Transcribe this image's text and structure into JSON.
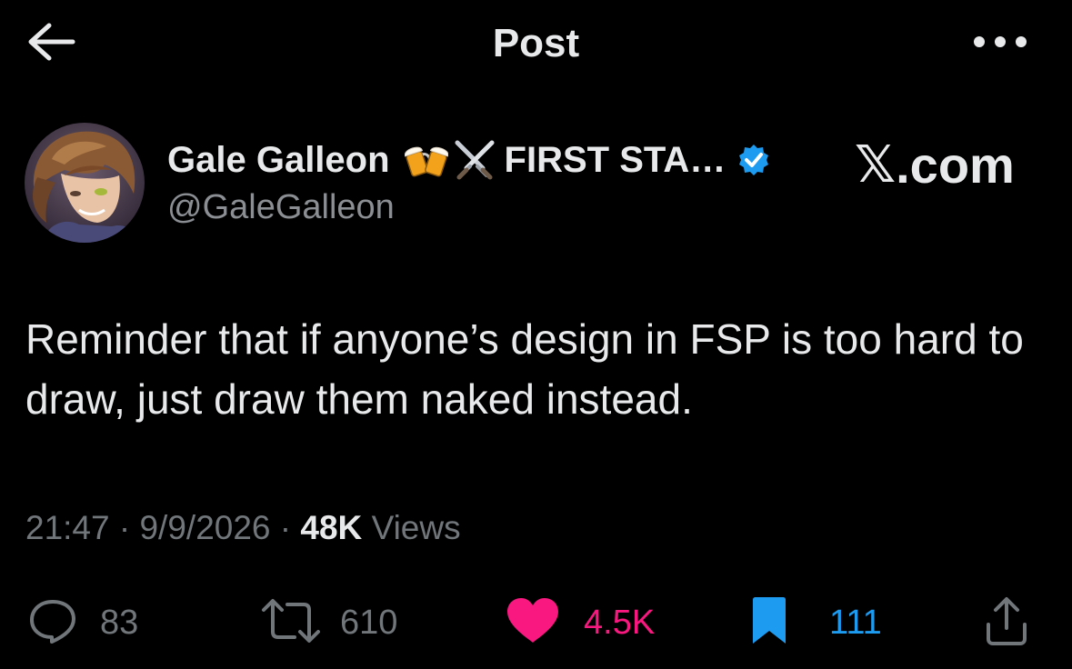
{
  "header": {
    "title": "Post",
    "back_icon": "arrow-left-icon",
    "more_icon": "ellipsis-icon"
  },
  "author": {
    "display_name": "Gale Galleon",
    "emojis": [
      "beer-mugs-icon",
      "crossed-swords-icon"
    ],
    "name_suffix": "FIRST STA…",
    "verified_icon": "verified-badge-icon",
    "handle": "@GaleGalleon",
    "avatar_icon": "avatar-image"
  },
  "brand": {
    "x": "𝕏",
    "dotcom": ".com"
  },
  "post": {
    "text": "Reminder that if anyone’s design in FSP is too hard to draw, just draw them naked instead."
  },
  "meta": {
    "time": "21:47",
    "separator": "·",
    "date": "9/9/2026",
    "views_count": "48K",
    "views_label": "Views"
  },
  "actions": {
    "reply": {
      "icon": "reply-bubble-icon",
      "count": "83"
    },
    "repost": {
      "icon": "repost-icon",
      "count": "610"
    },
    "like": {
      "icon": "heart-icon",
      "count": "4.5K"
    },
    "bookmark": {
      "icon": "bookmark-icon",
      "count": "111"
    },
    "share": {
      "icon": "share-icon"
    }
  },
  "colors": {
    "background": "#000000",
    "text_primary": "#e7e9ea",
    "text_secondary": "#71767b",
    "like_pink": "#f91880",
    "bookmark_blue": "#1d9bf0",
    "verified_blue": "#1d9bf0"
  }
}
